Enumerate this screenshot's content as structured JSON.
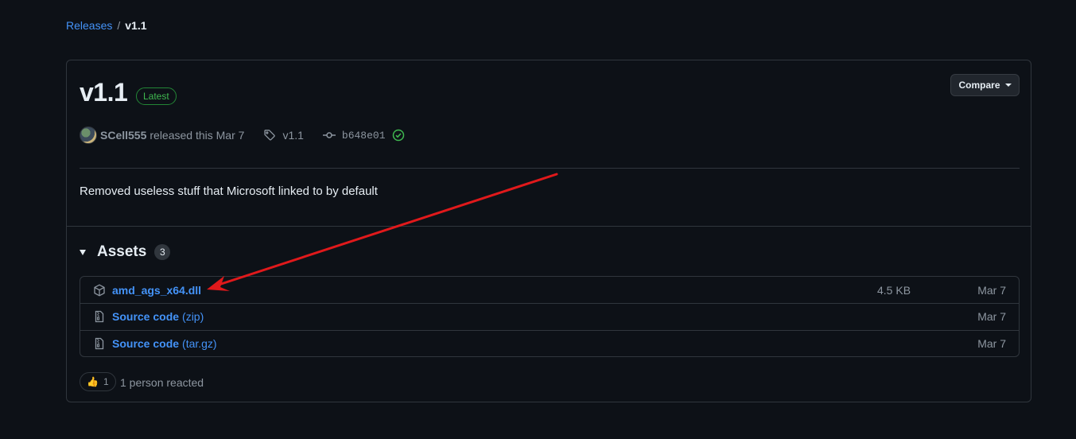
{
  "breadcrumb": {
    "parent": "Releases",
    "separator": "/",
    "current": "v1.1"
  },
  "release": {
    "title": "v1.1",
    "badge": "Latest",
    "compare_label": "Compare",
    "author": "SCell555",
    "released_text": "released this Mar 7",
    "tag": "v1.1",
    "commit": "b648e01",
    "body": "Removed useless stuff that Microsoft linked to by default"
  },
  "assets": {
    "title": "Assets",
    "count": "3",
    "items": [
      {
        "name": "amd_ags_x64.dll",
        "suffix": "",
        "size": "4.5 KB",
        "date": "Mar 7",
        "icon": "package-icon"
      },
      {
        "name": "Source code",
        "suffix": "(zip)",
        "size": "",
        "date": "Mar 7",
        "icon": "file-zip-icon"
      },
      {
        "name": "Source code",
        "suffix": "(tar.gz)",
        "size": "",
        "date": "Mar 7",
        "icon": "file-zip-icon"
      }
    ]
  },
  "reactions": {
    "emoji": "👍",
    "count": "1",
    "summary": "1 person reacted"
  },
  "colors": {
    "background": "#0d1117",
    "link": "#4493f8",
    "success": "#3fb950",
    "annotation_arrow": "#e0191b"
  }
}
